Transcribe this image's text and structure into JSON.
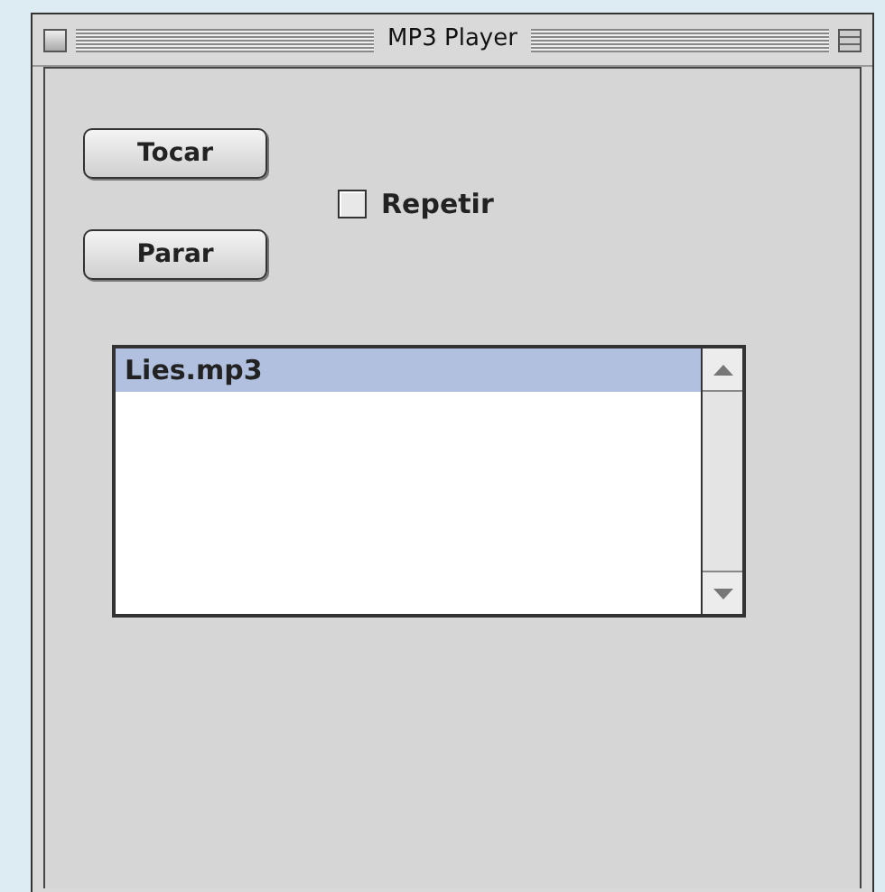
{
  "window": {
    "title": "MP3 Player"
  },
  "buttons": [
    {
      "label": "Tocar"
    },
    {
      "label": "Parar"
    }
  ],
  "checkbox": {
    "label": "Repetir",
    "checked": false
  },
  "list": {
    "items": [
      {
        "label": "Lies.mp3",
        "selected": true
      }
    ]
  }
}
